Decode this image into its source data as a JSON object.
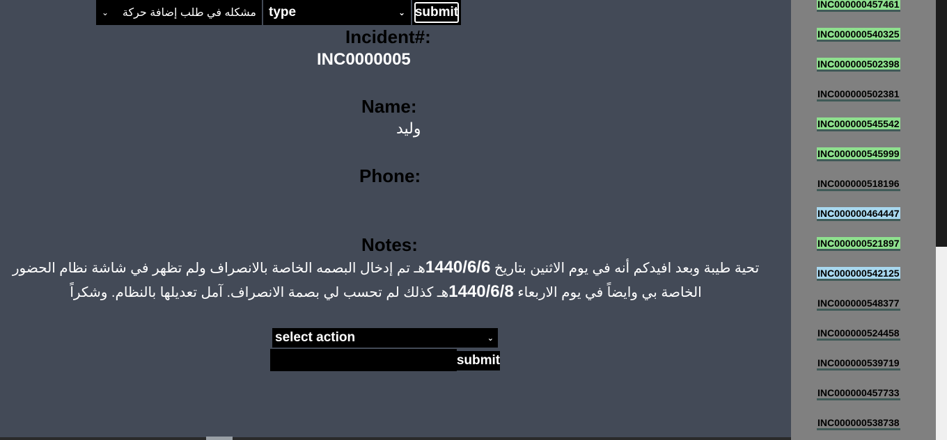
{
  "filters": {
    "category_value": "مشكله في طلب إضافة حركة",
    "type_value": "type",
    "submit_label": "submit"
  },
  "incident": {
    "number_label": "Incident#:",
    "number_value": "INC0000005",
    "name_label": "Name:",
    "name_value": "وليد",
    "phone_label": "Phone:",
    "phone_value": "",
    "notes_label": "Notes:",
    "notes_part1": "تحية طيبة وبعد افيدكم أنه في يوم الاثنين بتاريخ ",
    "notes_date1": "1440/6/6",
    "notes_part2": "هـ تم إدخال البصمه الخاصة بالانصراف ولم تظهر في شاشة نظام الحضور الخاصة بي وايضاً في يوم الاربعاء ",
    "notes_date2": "1440/6/8",
    "notes_part3": "هـ كذلك لم تحسب لي بصمة الانصراف. آمل تعديلها بالنظام. وشكراً"
  },
  "action_form": {
    "select_value": "select action",
    "input_value": "",
    "submit_label": "submit"
  },
  "sidebar": {
    "incidents": [
      {
        "id": "INC000000457461",
        "status": "green"
      },
      {
        "id": "INC000000540325",
        "status": "green"
      },
      {
        "id": "INC000000502398",
        "status": "green"
      },
      {
        "id": "INC000000502381",
        "status": "none"
      },
      {
        "id": "INC000000545542",
        "status": "green"
      },
      {
        "id": "INC000000545999",
        "status": "green"
      },
      {
        "id": "INC000000518196",
        "status": "none"
      },
      {
        "id": "INC000000464447",
        "status": "blue"
      },
      {
        "id": "INC000000521897",
        "status": "green"
      },
      {
        "id": "INC000000542125",
        "status": "blue"
      },
      {
        "id": "INC000000548377",
        "status": "none"
      },
      {
        "id": "INC000000524458",
        "status": "none"
      },
      {
        "id": "INC000000539719",
        "status": "none"
      },
      {
        "id": "INC000000457733",
        "status": "none"
      },
      {
        "id": "INC000000538738",
        "status": "none"
      }
    ]
  },
  "colors": {
    "background": "#434a57",
    "sidebar": "#808080",
    "status_green": "#8ee08e",
    "status_blue": "#a8d8ef"
  }
}
